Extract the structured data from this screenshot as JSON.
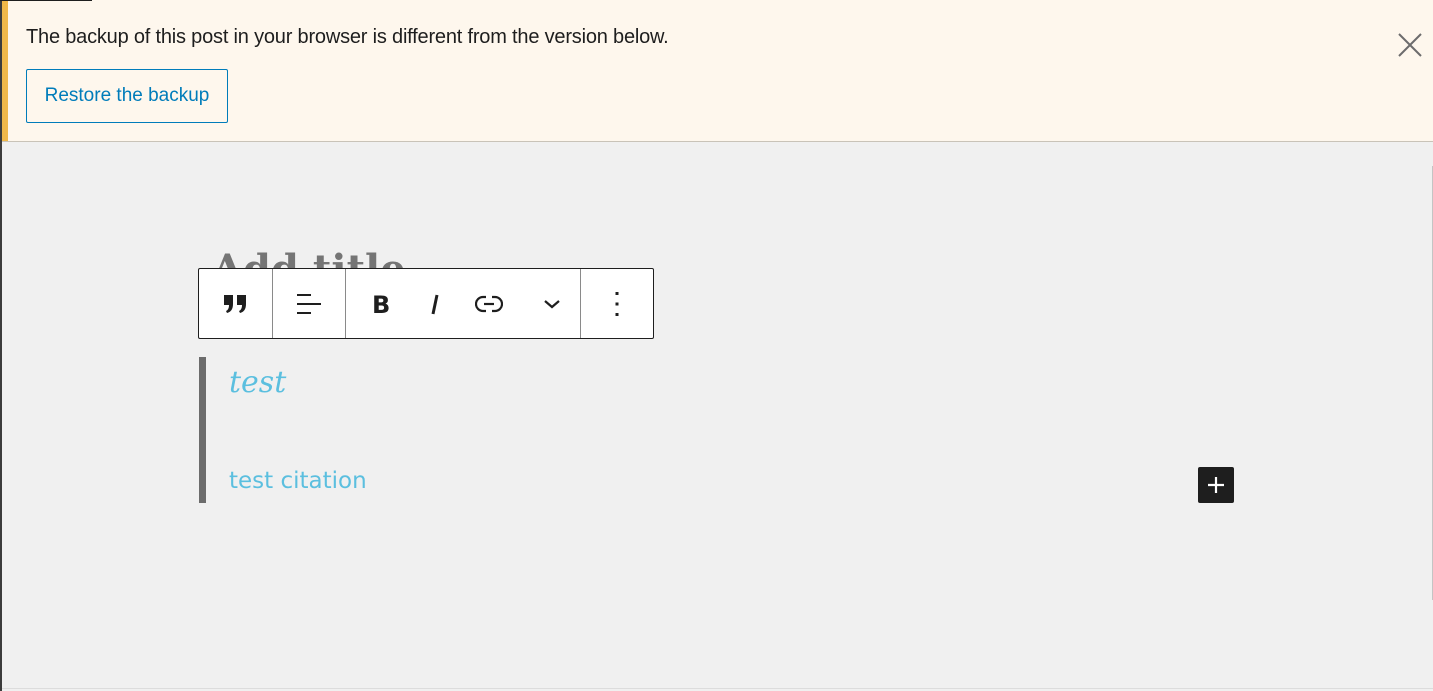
{
  "notice": {
    "message": "The backup of this post in your browser is different from the version below.",
    "restore_button": "Restore the backup",
    "close_icon": "close-icon",
    "accent_color": "#f0b849",
    "background_color": "#fef7ed"
  },
  "editor": {
    "title_placeholder": "Add title",
    "toolbar": {
      "groups": [
        {
          "items": [
            {
              "name": "quote",
              "icon": "quote-icon",
              "label": "Quote"
            }
          ]
        },
        {
          "items": [
            {
              "name": "align",
              "icon": "align-left-icon",
              "label": "Align"
            }
          ]
        },
        {
          "items": [
            {
              "name": "bold",
              "icon": "bold-icon",
              "label": "B"
            },
            {
              "name": "italic",
              "icon": "italic-icon",
              "label": "I"
            },
            {
              "name": "link",
              "icon": "link-icon",
              "label": "Link"
            },
            {
              "name": "more-rich-text",
              "icon": "chevron-down-icon",
              "label": "More"
            }
          ]
        },
        {
          "items": [
            {
              "name": "options",
              "icon": "more-vertical-icon",
              "label": "Options"
            }
          ]
        }
      ]
    },
    "quote": {
      "text": "test",
      "citation": "test citation",
      "text_color": "#5bbfdf"
    },
    "inserter_icon": "plus-icon"
  }
}
